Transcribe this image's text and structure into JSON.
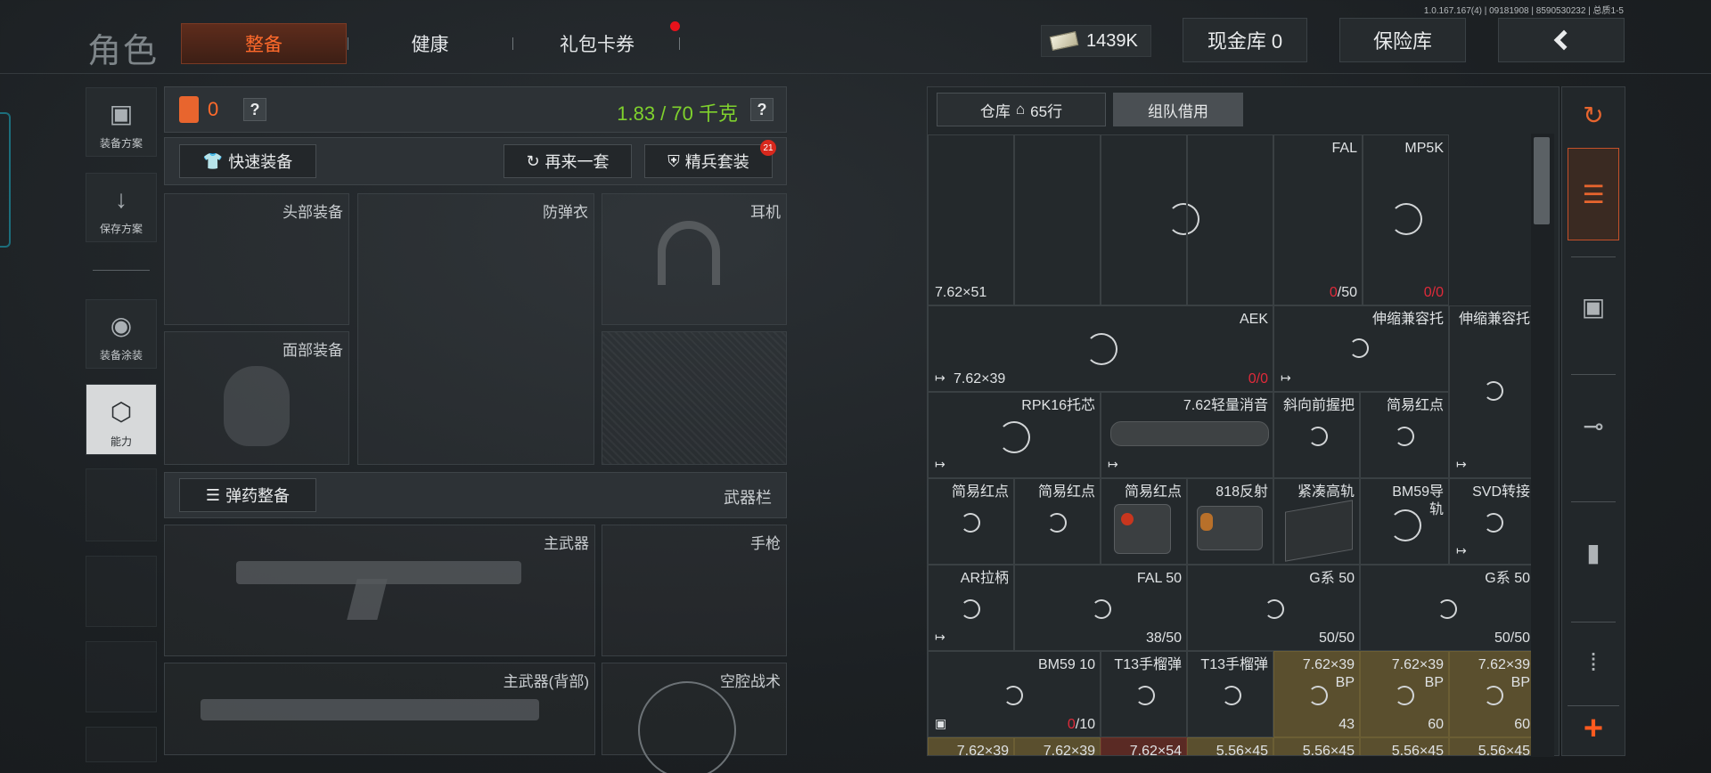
{
  "version": "1.0.167.167(4) | 09181908 | 8590530232 | 总质1-5",
  "header": {
    "title": "角色",
    "tabs": [
      {
        "label": "整备",
        "active": true
      },
      {
        "label": "健康",
        "active": false
      },
      {
        "label": "礼包卡券",
        "active": false,
        "has_notification": true
      }
    ],
    "money": "1439K",
    "cash_vault": "现金库 0",
    "insurance_vault": "保险库"
  },
  "left_menu": [
    {
      "label": "装备方案",
      "icon": "vest-icon"
    },
    {
      "label": "保存方案",
      "icon": "download-icon"
    },
    {
      "label": "装备涂装",
      "icon": "helmet-icon"
    },
    {
      "label": "能力",
      "icon": "ability-icon",
      "active": true
    }
  ],
  "loadout": {
    "armor_value": "0",
    "weight": "1.83 / 70 千克",
    "quick_equip": "快速装备",
    "again": "再来一套",
    "elite_set": "精兵套装",
    "elite_badge": "21",
    "slots": {
      "head": "头部装备",
      "armor": "防弹衣",
      "headset": "耳机",
      "face": "面部装备"
    },
    "ammo_equip": "弹药整备",
    "weapon_bar": "武器栏",
    "weapon_slots": {
      "primary": "主武器",
      "pistol": "手枪",
      "primary_back": "主武器(背部)",
      "melee": "空腔战术"
    }
  },
  "inventory": {
    "tabs": [
      {
        "label": "仓库",
        "rows": "65行",
        "icon": "home-icon"
      },
      {
        "label": "组队借用"
      }
    ],
    "cells": {
      "r1": {
        "fal": "FAL",
        "mp5k": "MP5K",
        "cal": "7.62×51",
        "fal_cnt_a": "0",
        "fal_cnt_b": "/50",
        "mp5_cnt_a": "0",
        "mp5_cnt_b": "/0"
      },
      "r2": {
        "aek": "AEK",
        "cal": "7.62×39",
        "cnt_a": "0",
        "cnt_b": "/0",
        "stock1": "伸缩兼容托",
        "stock2": "伸缩兼容托"
      },
      "r3": {
        "rpk": "RPK16托芯",
        "suppressor": "7.62轻量消音",
        "grip": "斜向前握把",
        "reddot": "简易红点"
      },
      "r4": {
        "c1": "简易红点",
        "c2": "简易红点",
        "c3": "简易红点",
        "c4": "818反射",
        "c5": "紧凑高轨",
        "c6": "BM59导轨",
        "c7": "SVD转接"
      },
      "r5": {
        "c1": "AR拉柄",
        "c2": "FAL 50",
        "c2cnt": "38/50",
        "c3": "G系 50",
        "c3cnt": "50/50",
        "c4": "G系 50",
        "c4cnt": "50/50"
      },
      "r6": {
        "c1": "BM59 10",
        "c1cnt_a": "0",
        "c1cnt_b": "/10",
        "c2": "T13手榴弹",
        "c3": "T13手榴弹",
        "c4": "7.62×39 BP",
        "c4cnt": "43",
        "c5": "7.62×39 BP",
        "c5cnt": "60",
        "c6": "7.62×39 BP",
        "c6cnt": "60"
      },
      "r7": {
        "c1": "7.62×39",
        "c2": "7.62×39",
        "c3": "7.62×54",
        "c4": "5.56×45",
        "c5": "5.56×45",
        "c6": "5.56×45",
        "c7": "5.56×45"
      }
    }
  },
  "right_rail": [
    {
      "icon": "stack-refresh-icon"
    },
    {
      "icon": "layers-icon",
      "active": true
    },
    {
      "icon": "armor-icon"
    },
    {
      "icon": "rifle-icon"
    },
    {
      "icon": "magazine-icon"
    },
    {
      "icon": "ammo-icon"
    },
    {
      "icon": "plus-icon"
    }
  ],
  "colors": {
    "accent": "#ff6a2b",
    "weight_green": "#7fd12d",
    "red_count": "#e02a3a",
    "gold_cell": "#5a4f2e"
  }
}
